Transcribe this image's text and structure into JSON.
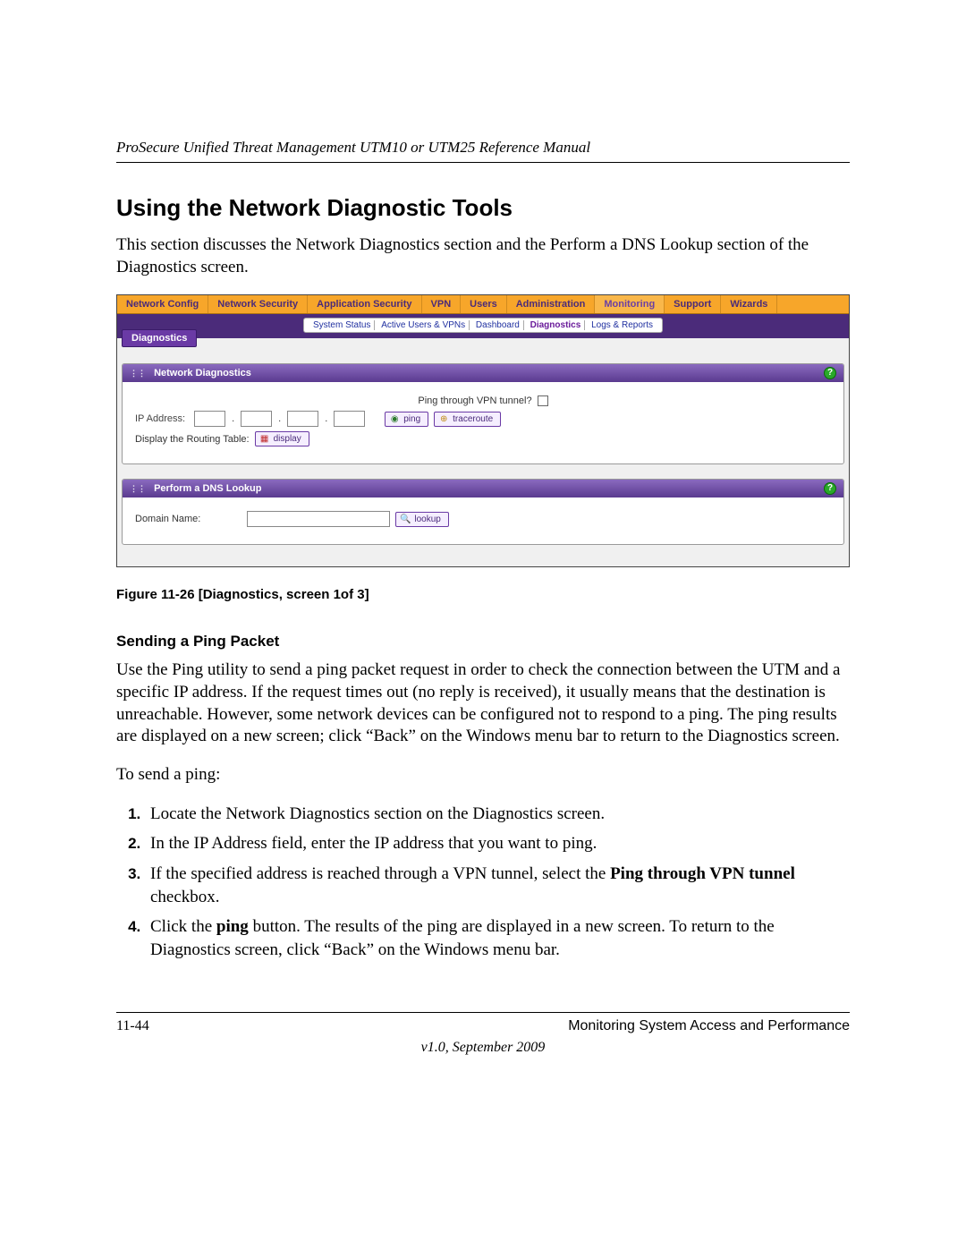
{
  "header": {
    "running": "ProSecure Unified Threat Management UTM10 or UTM25 Reference Manual"
  },
  "section": {
    "title": "Using the Network Diagnostic Tools",
    "intro": "This section discusses the Network Diagnostics section and the Perform a DNS Lookup section of the Diagnostics screen."
  },
  "screenshot": {
    "tabs": [
      "Network Config",
      "Network Security",
      "Application Security",
      "VPN",
      "Users",
      "Administration",
      "Monitoring",
      "Support",
      "Wizards"
    ],
    "active_tab_index": 6,
    "subtabs": [
      "System Status",
      "Active Users & VPNs",
      "Dashboard",
      "Diagnostics",
      "Logs & Reports"
    ],
    "active_subtab_index": 3,
    "diagnostics_chip": "Diagnostics",
    "panel1": {
      "title": "Network Diagnostics",
      "ping_vpn_label": "Ping through VPN tunnel?",
      "ip_label": "IP Address:",
      "ping_btn": "ping",
      "traceroute_btn": "traceroute",
      "routing_label": "Display the Routing Table:",
      "display_btn": "display"
    },
    "panel2": {
      "title": "Perform a DNS Lookup",
      "domain_label": "Domain Name:",
      "lookup_btn": "lookup"
    }
  },
  "figure_caption": "Figure 11-26 [Diagnostics, screen 1of 3]",
  "subsection": {
    "title": "Sending a Ping Packet",
    "para": "Use the Ping utility to send a ping packet request in order to check the connection between the UTM and a specific IP address. If the request times out (no reply is received), it usually means that the destination is unreachable. However, some network devices can be configured not to respond to a ping. The ping results are displayed on a new screen; click “Back” on the Windows menu bar to return to the Diagnostics screen.",
    "lead": "To send a ping:",
    "steps": [
      {
        "text": "Locate the Network Diagnostics section on the Diagnostics screen."
      },
      {
        "text": "In the IP Address field, enter the IP address that you want to ping."
      },
      {
        "prefix": "If the specified address is reached through a VPN tunnel, select the ",
        "bold": "Ping through VPN tunnel",
        "suffix": " checkbox."
      },
      {
        "prefix": "Click the ",
        "bold": "ping",
        "suffix": " button. The results of the ping are displayed in a new screen. To return to the Diagnostics screen, click “Back” on the Windows menu bar."
      }
    ]
  },
  "footer": {
    "page": "11-44",
    "right": "Monitoring System Access and Performance",
    "center": "v1.0, September 2009"
  }
}
